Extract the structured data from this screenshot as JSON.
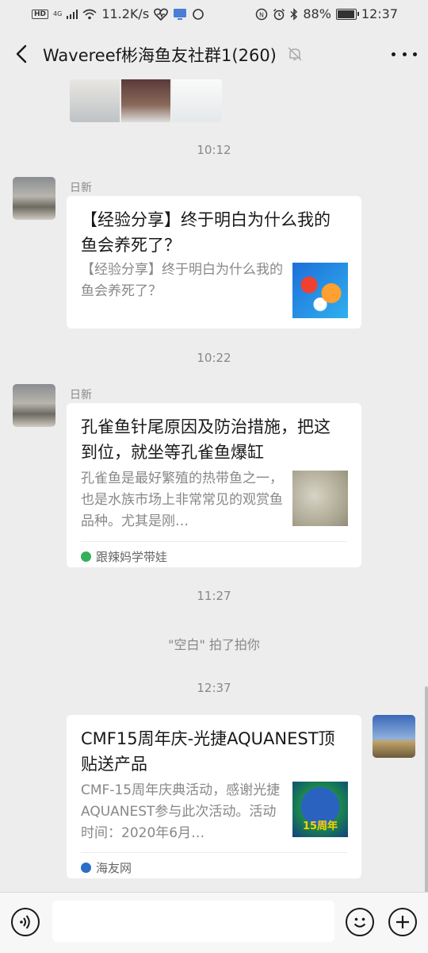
{
  "status": {
    "network": "4G",
    "speed": "11.2K/s",
    "battery": "88%",
    "battery_level": 0.88,
    "time": "12:37"
  },
  "header": {
    "title": "Wavereef彬海鱼友社群1(260)"
  },
  "messages": {
    "time1": "10:12",
    "msg1": {
      "sender": "日新",
      "title": "【经验分享】终于明白为什么我的鱼会养死了？",
      "desc": "【经验分享】终于明白为什么我的鱼会养死了？"
    },
    "time2": "10:22",
    "msg2": {
      "sender": "日新",
      "title": "孔雀鱼针尾原因及防治措施，把这到位，就坐等孔雀鱼爆缸",
      "desc": "孔雀鱼是最好繁殖的热带鱼之一，也是水族市场上非常常见的观赏鱼品种。尤其是刚…",
      "source": "跟辣妈学带娃"
    },
    "time3": "11:27",
    "system": "\"空白\" 拍了拍你",
    "time4": "12:37",
    "msg3": {
      "title": "CMF15周年庆-光捷AQUANEST顶贴送产品",
      "desc": "CMF-15周年庆典活动，感谢光捷AQUANEST参与此次活动。活动时间：2020年6月…",
      "thumb_text": "15周年",
      "source": "海友网"
    }
  },
  "input": {
    "value": ""
  },
  "colors": {
    "background": "#ededed",
    "card": "#ffffff",
    "muted_text": "#888888"
  }
}
